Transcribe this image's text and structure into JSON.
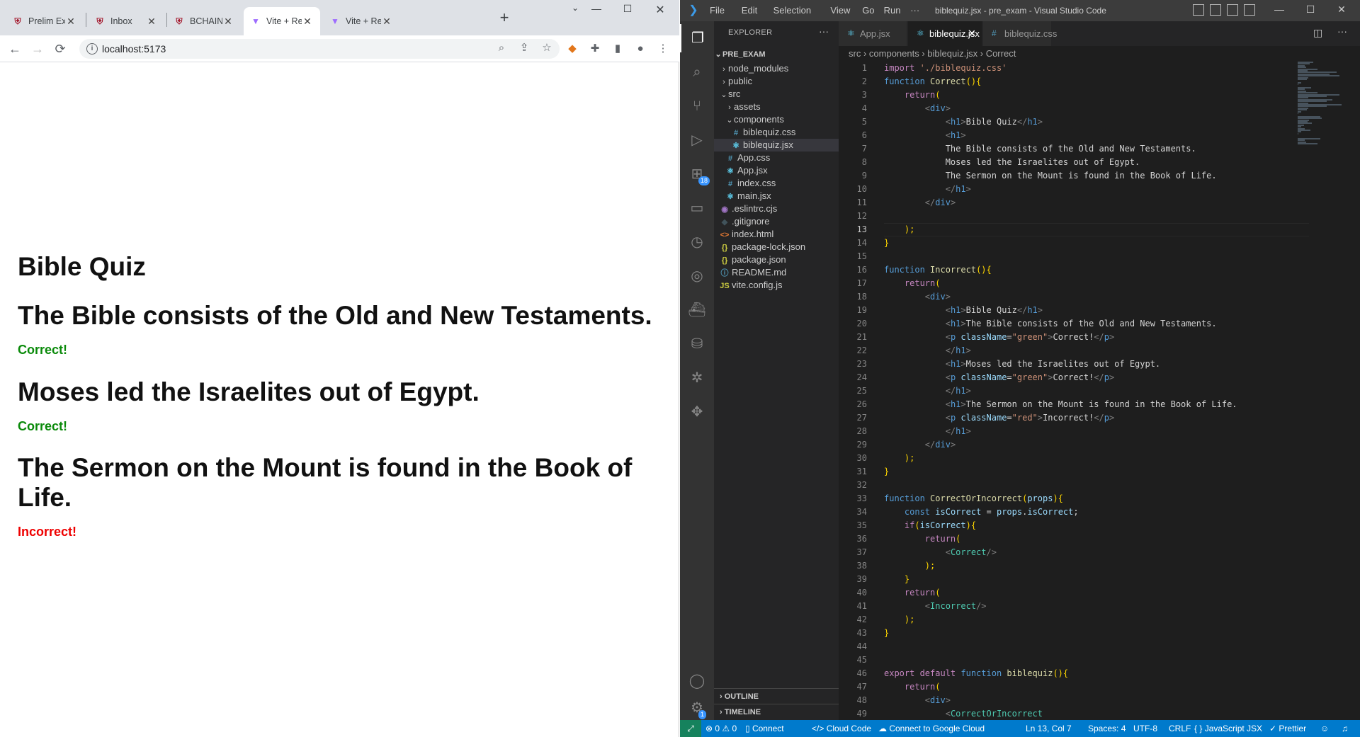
{
  "browser": {
    "tabs": [
      {
        "title": "Prelim Exam (",
        "icon": "institution-icon",
        "active": false
      },
      {
        "title": "Inbox",
        "icon": "institution-icon",
        "active": false
      },
      {
        "title": "BCHAIN-WEE",
        "icon": "institution-icon",
        "active": false
      },
      {
        "title": "Vite + React",
        "icon": "vite-icon",
        "active": true
      },
      {
        "title": "Vite + React",
        "icon": "vite-icon",
        "active": false
      }
    ],
    "new_tab": "+",
    "url": "localhost:5173"
  },
  "page": {
    "title": "Bible Quiz",
    "questions": [
      {
        "text": "The Bible consists of the Old and New Testaments.",
        "result": "Correct!",
        "color": "#0a8a0a"
      },
      {
        "text": "Moses led the Israelites out of Egypt.",
        "result": "Correct!",
        "color": "#0a8a0a"
      },
      {
        "text": "The Sermon on the Mount is found in the Book of Life.",
        "result": "Incorrect!",
        "color": "#e00000"
      }
    ]
  },
  "vscode": {
    "menu": [
      "File",
      "Edit",
      "Selection",
      "View",
      "Go",
      "Run",
      "···"
    ],
    "window_title": "biblequiz.jsx - pre_exam - Visual Studio Code",
    "extensions_badge": "18",
    "settings_badge": "1",
    "explorer": {
      "header": "EXPLORER",
      "project": "PRE_EXAM",
      "items": [
        {
          "label": "node_modules",
          "type": "folder",
          "depth": 1,
          "open": false
        },
        {
          "label": "public",
          "type": "folder",
          "depth": 1,
          "open": false
        },
        {
          "label": "src",
          "type": "folder",
          "depth": 1,
          "open": true
        },
        {
          "label": "assets",
          "type": "folder",
          "depth": 2,
          "open": false
        },
        {
          "label": "components",
          "type": "folder",
          "depth": 2,
          "open": true
        },
        {
          "label": "biblequiz.css",
          "type": "css",
          "depth": 3
        },
        {
          "label": "biblequiz.jsx",
          "type": "jsx",
          "depth": 3,
          "selected": true
        },
        {
          "label": "App.css",
          "type": "css",
          "depth": 2
        },
        {
          "label": "App.jsx",
          "type": "jsx",
          "depth": 2
        },
        {
          "label": "index.css",
          "type": "css",
          "depth": 2
        },
        {
          "label": "main.jsx",
          "type": "jsx",
          "depth": 2
        },
        {
          "label": ".eslintrc.cjs",
          "type": "eslint",
          "depth": 1
        },
        {
          "label": ".gitignore",
          "type": "git",
          "depth": 1
        },
        {
          "label": "index.html",
          "type": "html",
          "depth": 1
        },
        {
          "label": "package-lock.json",
          "type": "json",
          "depth": 1
        },
        {
          "label": "package.json",
          "type": "json",
          "depth": 1
        },
        {
          "label": "README.md",
          "type": "info",
          "depth": 1
        },
        {
          "label": "vite.config.js",
          "type": "js",
          "depth": 1
        }
      ],
      "outline": "OUTLINE",
      "timeline": "TIMELINE"
    },
    "tabs": [
      {
        "label": "App.jsx",
        "active": false,
        "icon": "react-icon"
      },
      {
        "label": "biblequiz.jsx",
        "active": true,
        "icon": "react-icon"
      },
      {
        "label": "biblequiz.css",
        "active": false,
        "icon": "css-icon"
      }
    ],
    "breadcrumb": [
      "src",
      "components",
      "biblequiz.jsx",
      "Correct"
    ],
    "current_line": 13,
    "code": [
      [
        [
          "s",
          "import "
        ],
        [
          "t",
          "'./biblequiz.css'"
        ]
      ],
      [
        [
          "k",
          "function "
        ],
        [
          "f",
          "Correct"
        ],
        [
          "p",
          "(){"
        ]
      ],
      [
        [
          "i",
          "    "
        ],
        [
          "c",
          "return"
        ],
        [
          "p",
          "("
        ]
      ],
      [
        [
          "i",
          "        "
        ],
        [
          "g",
          "<"
        ],
        [
          "h",
          "div"
        ],
        [
          "g",
          ">"
        ]
      ],
      [
        [
          "i",
          "            "
        ],
        [
          "g",
          "<"
        ],
        [
          "h",
          "h1"
        ],
        [
          "g",
          ">"
        ],
        [
          "x",
          "Bible Quiz"
        ],
        [
          "g",
          "</"
        ],
        [
          "h",
          "h1"
        ],
        [
          "g",
          ">"
        ]
      ],
      [
        [
          "i",
          "            "
        ],
        [
          "g",
          "<"
        ],
        [
          "h",
          "h1"
        ],
        [
          "g",
          ">"
        ]
      ],
      [
        [
          "i",
          "            "
        ],
        [
          "x",
          "The Bible consists of the Old and New Testaments."
        ]
      ],
      [
        [
          "i",
          "            "
        ],
        [
          "x",
          "Moses led the Israelites out of Egypt."
        ]
      ],
      [
        [
          "i",
          "            "
        ],
        [
          "x",
          "The Sermon on the Mount is found in the Book of Life."
        ]
      ],
      [
        [
          "i",
          "            "
        ],
        [
          "g",
          "</"
        ],
        [
          "h",
          "h1"
        ],
        [
          "g",
          ">"
        ]
      ],
      [
        [
          "i",
          "        "
        ],
        [
          "g",
          "</"
        ],
        [
          "h",
          "div"
        ],
        [
          "g",
          ">"
        ]
      ],
      [],
      [
        [
          "i",
          "    "
        ],
        [
          "p",
          ");"
        ]
      ],
      [
        [
          "p",
          "}"
        ]
      ],
      [],
      [
        [
          "k",
          "function "
        ],
        [
          "f",
          "Incorrect"
        ],
        [
          "p",
          "(){"
        ]
      ],
      [
        [
          "i",
          "    "
        ],
        [
          "c",
          "return"
        ],
        [
          "p",
          "("
        ]
      ],
      [
        [
          "i",
          "        "
        ],
        [
          "g",
          "<"
        ],
        [
          "h",
          "div"
        ],
        [
          "g",
          ">"
        ]
      ],
      [
        [
          "i",
          "            "
        ],
        [
          "g",
          "<"
        ],
        [
          "h",
          "h1"
        ],
        [
          "g",
          ">"
        ],
        [
          "x",
          "Bible Quiz"
        ],
        [
          "g",
          "</"
        ],
        [
          "h",
          "h1"
        ],
        [
          "g",
          ">"
        ]
      ],
      [
        [
          "i",
          "            "
        ],
        [
          "g",
          "<"
        ],
        [
          "h",
          "h1"
        ],
        [
          "g",
          ">"
        ],
        [
          "x",
          "The Bible consists of the Old and New Testaments."
        ]
      ],
      [
        [
          "i",
          "            "
        ],
        [
          "g",
          "<"
        ],
        [
          "h",
          "p "
        ],
        [
          "a",
          "className"
        ],
        [
          "x",
          "="
        ],
        [
          "t",
          "\"green\""
        ],
        [
          "g",
          ">"
        ],
        [
          "x",
          "Correct!"
        ],
        [
          "g",
          "</"
        ],
        [
          "h",
          "p"
        ],
        [
          "g",
          ">"
        ]
      ],
      [
        [
          "i",
          "            "
        ],
        [
          "g",
          "</"
        ],
        [
          "h",
          "h1"
        ],
        [
          "g",
          ">"
        ]
      ],
      [
        [
          "i",
          "            "
        ],
        [
          "g",
          "<"
        ],
        [
          "h",
          "h1"
        ],
        [
          "g",
          ">"
        ],
        [
          "x",
          "Moses led the Israelites out of Egypt."
        ]
      ],
      [
        [
          "i",
          "            "
        ],
        [
          "g",
          "<"
        ],
        [
          "h",
          "p "
        ],
        [
          "a",
          "className"
        ],
        [
          "x",
          "="
        ],
        [
          "t",
          "\"green\""
        ],
        [
          "g",
          ">"
        ],
        [
          "x",
          "Correct!"
        ],
        [
          "g",
          "</"
        ],
        [
          "h",
          "p"
        ],
        [
          "g",
          ">"
        ]
      ],
      [
        [
          "i",
          "            "
        ],
        [
          "g",
          "</"
        ],
        [
          "h",
          "h1"
        ],
        [
          "g",
          ">"
        ]
      ],
      [
        [
          "i",
          "            "
        ],
        [
          "g",
          "<"
        ],
        [
          "h",
          "h1"
        ],
        [
          "g",
          ">"
        ],
        [
          "x",
          "The Sermon on the Mount is found in the Book of Life."
        ]
      ],
      [
        [
          "i",
          "            "
        ],
        [
          "g",
          "<"
        ],
        [
          "h",
          "p "
        ],
        [
          "a",
          "className"
        ],
        [
          "x",
          "="
        ],
        [
          "t",
          "\"red\""
        ],
        [
          "g",
          ">"
        ],
        [
          "x",
          "Incorrect!"
        ],
        [
          "g",
          "</"
        ],
        [
          "h",
          "p"
        ],
        [
          "g",
          ">"
        ]
      ],
      [
        [
          "i",
          "            "
        ],
        [
          "g",
          "</"
        ],
        [
          "h",
          "h1"
        ],
        [
          "g",
          ">"
        ]
      ],
      [
        [
          "i",
          "        "
        ],
        [
          "g",
          "</"
        ],
        [
          "h",
          "div"
        ],
        [
          "g",
          ">"
        ]
      ],
      [
        [
          "i",
          "    "
        ],
        [
          "p",
          ");"
        ]
      ],
      [
        [
          "p",
          "}"
        ]
      ],
      [],
      [
        [
          "k",
          "function "
        ],
        [
          "f",
          "CorrectOrIncorrect"
        ],
        [
          "p",
          "("
        ],
        [
          "v",
          "props"
        ],
        [
          "p",
          "){"
        ]
      ],
      [
        [
          "i",
          "    "
        ],
        [
          "k",
          "const "
        ],
        [
          "v",
          "isCorrect"
        ],
        [
          "x",
          " = "
        ],
        [
          "v",
          "props"
        ],
        [
          "x",
          "."
        ],
        [
          "v",
          "isCorrect"
        ],
        [
          "x",
          ";"
        ]
      ],
      [
        [
          "i",
          "    "
        ],
        [
          "c",
          "if"
        ],
        [
          "p",
          "("
        ],
        [
          "v",
          "isCorrect"
        ],
        [
          "p",
          "){"
        ]
      ],
      [
        [
          "i",
          "        "
        ],
        [
          "c",
          "return"
        ],
        [
          "p",
          "("
        ]
      ],
      [
        [
          "i",
          "            "
        ],
        [
          "g",
          "<"
        ],
        [
          "n",
          "Correct"
        ],
        [
          "g",
          "/>"
        ]
      ],
      [
        [
          "i",
          "        "
        ],
        [
          "p",
          ");"
        ]
      ],
      [
        [
          "i",
          "    "
        ],
        [
          "p",
          "}"
        ]
      ],
      [
        [
          "i",
          "    "
        ],
        [
          "c",
          "return"
        ],
        [
          "p",
          "("
        ]
      ],
      [
        [
          "i",
          "        "
        ],
        [
          "g",
          "<"
        ],
        [
          "n",
          "Incorrect"
        ],
        [
          "g",
          "/>"
        ]
      ],
      [
        [
          "i",
          "    "
        ],
        [
          "p",
          ");"
        ]
      ],
      [
        [
          "p",
          "}"
        ]
      ],
      [],
      [],
      [
        [
          "c",
          "export "
        ],
        [
          "c",
          "default "
        ],
        [
          "k",
          "function "
        ],
        [
          "f",
          "biblequiz"
        ],
        [
          "p",
          "(){"
        ]
      ],
      [
        [
          "i",
          "    "
        ],
        [
          "c",
          "return"
        ],
        [
          "p",
          "("
        ]
      ],
      [
        [
          "i",
          "        "
        ],
        [
          "g",
          "<"
        ],
        [
          "h",
          "div"
        ],
        [
          "g",
          ">"
        ]
      ],
      [
        [
          "i",
          "            "
        ],
        [
          "g",
          "<"
        ],
        [
          "n",
          "CorrectOrIncorrect"
        ]
      ]
    ],
    "syntax_colors": {
      "s": "#c586c0",
      "t": "#ce9178",
      "k": "#569cd6",
      "f": "#dcdcaa",
      "p": "#ffd700",
      "c": "#c586c0",
      "g": "#808080",
      "h": "#569cd6",
      "x": "#d4d4d4",
      "a": "#9cdcfe",
      "v": "#9cdcfe",
      "n": "#4ec9b0",
      "i": "#d4d4d4"
    },
    "status": {
      "errors": "0",
      "warnings": "0",
      "connect": "Connect",
      "cloud_code": "Cloud Code",
      "google_cloud": "Connect to Google Cloud",
      "position": "Ln 13, Col 7",
      "spaces": "Spaces: 4",
      "encoding": "UTF-8",
      "eol": "CRLF",
      "language": "JavaScript JSX",
      "prettier": "Prettier"
    }
  }
}
